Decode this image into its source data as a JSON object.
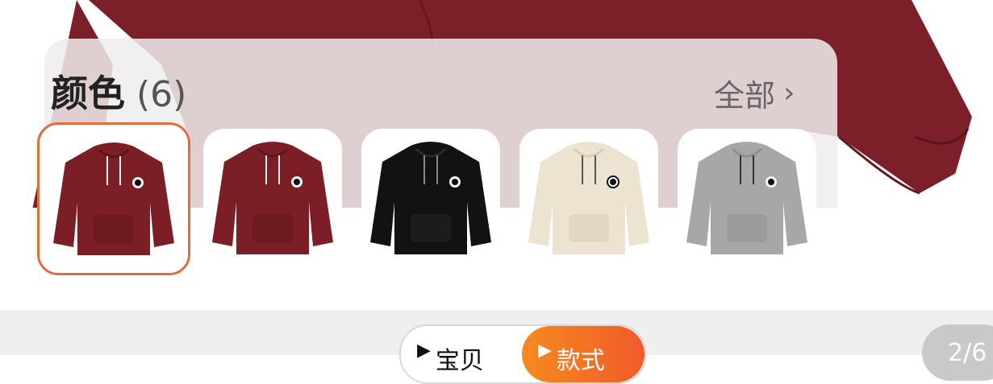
{
  "product": {
    "colors_title": "颜色",
    "colors_count": "(6)",
    "all_label": "全部",
    "selected_index": 0,
    "swatches": [
      {
        "color_name": "burgundy",
        "hex": "#7b1e26"
      },
      {
        "color_name": "burgundy",
        "hex": "#7b1e26"
      },
      {
        "color_name": "black",
        "hex": "#121212"
      },
      {
        "color_name": "cream",
        "hex": "#ece3d1"
      },
      {
        "color_name": "gray",
        "hex": "#a7a7a7"
      }
    ],
    "accent_color": "#e06d3a"
  },
  "media_switcher": {
    "tab_1": "宝贝",
    "tab_2": "款式",
    "active_tab": 1,
    "page_indicator": "2/6"
  },
  "icons": {
    "chevron": "chevron-right-icon",
    "play": "play-triangle-icon"
  }
}
